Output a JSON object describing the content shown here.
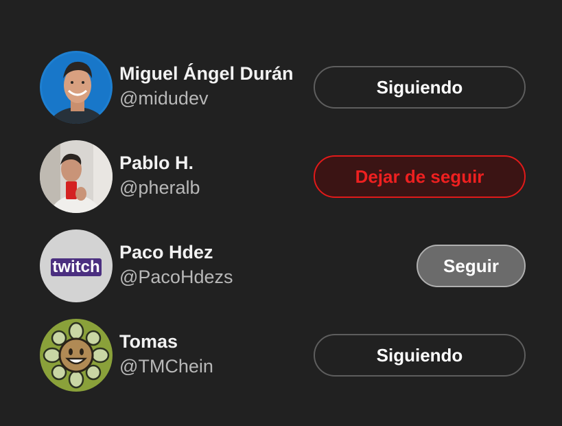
{
  "users": [
    {
      "name": "Miguel Ángel Durán",
      "handle": "@midudev",
      "button_label": "Siguiendo",
      "button_state": "following"
    },
    {
      "name": "Pablo H.",
      "handle": "@pheralb",
      "button_label": "Dejar de seguir",
      "button_state": "unfollow-hover"
    },
    {
      "name": "Paco Hdez",
      "handle": "@PacoHdezs",
      "button_label": "Seguir",
      "button_state": "not-following"
    },
    {
      "name": "Tomas",
      "handle": "@TMChein",
      "button_label": "Siguiendo",
      "button_state": "following"
    }
  ],
  "avatars": {
    "1": {
      "logo_text": "twitch"
    }
  },
  "colors": {
    "background": "#212121",
    "name_text": "#f2f2f2",
    "handle_text": "#b8b8b8",
    "following_border": "#5e5e5e",
    "unfollow_border": "#e21a1a",
    "unfollow_text": "#ee2020",
    "unfollow_bg": "#3b1414",
    "follow_bg": "#6b6b6b",
    "twitch_purple": "#6441a5"
  }
}
